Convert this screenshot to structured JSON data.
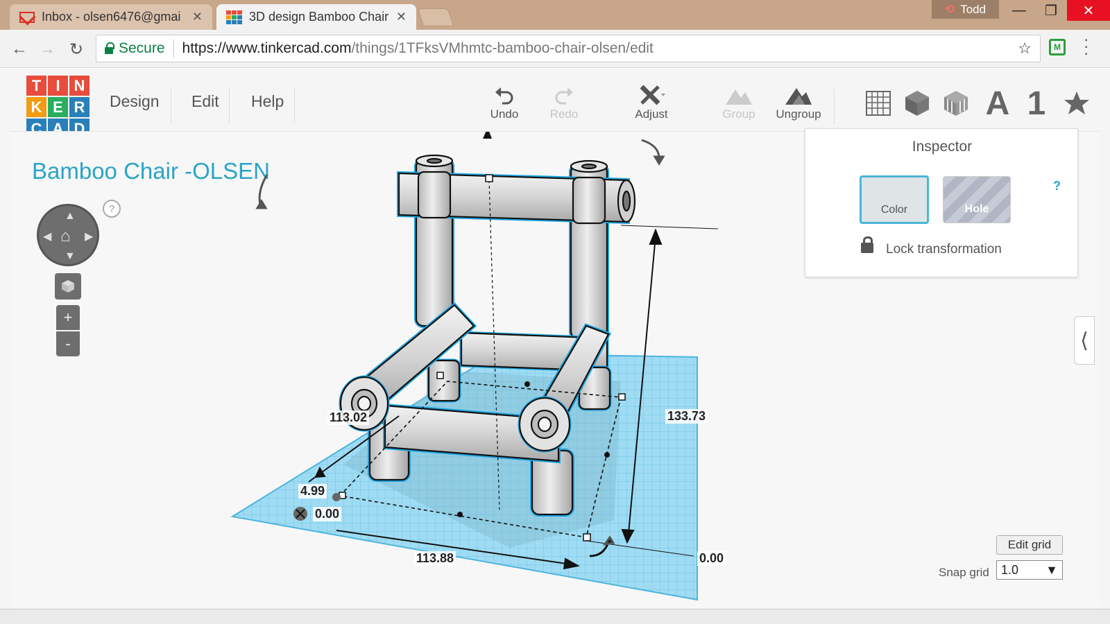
{
  "browser": {
    "tabs": [
      {
        "label": "Inbox - olsen6476@gmai"
      },
      {
        "label": "3D design Bamboo Chair"
      }
    ],
    "user": "Todd",
    "omnibox": {
      "secure": "Secure",
      "url_host": "https://www.tinkercad.com",
      "url_path": "/things/1TFksVMhmtc-bamboo-chair-olsen/edit"
    }
  },
  "app": {
    "logo": [
      "T",
      "I",
      "N",
      "K",
      "E",
      "R",
      "C",
      "A",
      "D"
    ],
    "menu": {
      "design": "Design",
      "edit": "Edit",
      "help": "Help"
    },
    "tools": {
      "undo": "Undo",
      "redo": "Redo",
      "adjust": "Adjust",
      "group": "Group",
      "ungroup": "Ungroup"
    },
    "shapes": {
      "letter": "A",
      "number": "1"
    },
    "design_title": "Bamboo Chair -OLSEN",
    "help_badge": "?",
    "zoom": {
      "in": "+",
      "out": "-"
    },
    "dimensions": {
      "length": "113.88",
      "width": "113.02",
      "height": "133.73",
      "elevation": "4.99",
      "x_offset": "0.00",
      "z_offset": "0.00"
    },
    "inspector": {
      "title": "Inspector",
      "color": "Color",
      "hole": "Hole",
      "help": "?",
      "lock": "Lock transformation"
    },
    "grid": {
      "edit_label": "Edit grid",
      "snap_label": "Snap grid",
      "snap_value": "1.0"
    },
    "colors": {
      "accent": "#29a4c8",
      "selection": "#1ea5e0",
      "plane": "#7dcdec",
      "logo": [
        "#e74c3c",
        "#e74c3c",
        "#e74c3c",
        "#f39c12",
        "#27ae60",
        "#2980b9",
        "#2980b9",
        "#2980b9",
        "#2980b9"
      ]
    }
  }
}
